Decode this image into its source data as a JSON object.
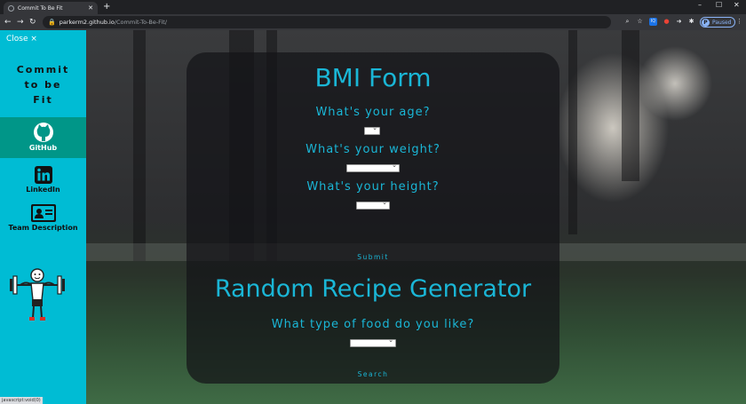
{
  "browser": {
    "tab_title": "Commit To Be Fit",
    "url_host": "parkerm2.github.io",
    "url_path": "/Commit-To-Be-Fit/",
    "profile_initial": "P",
    "profile_status": "Paused"
  },
  "sidebar": {
    "close_label": "Close ×",
    "brand_lines": [
      "Commit",
      "to be",
      "Fit"
    ],
    "items": [
      {
        "label": "GitHub",
        "icon": "github-icon"
      },
      {
        "label": "LinkedIn",
        "icon": "linkedin-icon"
      },
      {
        "label": "Team Description",
        "icon": "id-card-icon"
      }
    ],
    "mascot_icon": "weightlifter-icon",
    "status_hint": "javascript:void(0)"
  },
  "bmi_form": {
    "title": "BMI Form",
    "age_label": "What's your age?",
    "weight_label": "What's your weight?",
    "height_label": "What's your height?",
    "submit_label": "Submit"
  },
  "recipe": {
    "title": "Random Recipe Generator",
    "food_label": "What type of food do you like?",
    "search_label": "Search"
  },
  "colors": {
    "sidebar": "#00bcd4",
    "sidebar_active": "#009688",
    "accent_text": "#1ab6d6"
  }
}
